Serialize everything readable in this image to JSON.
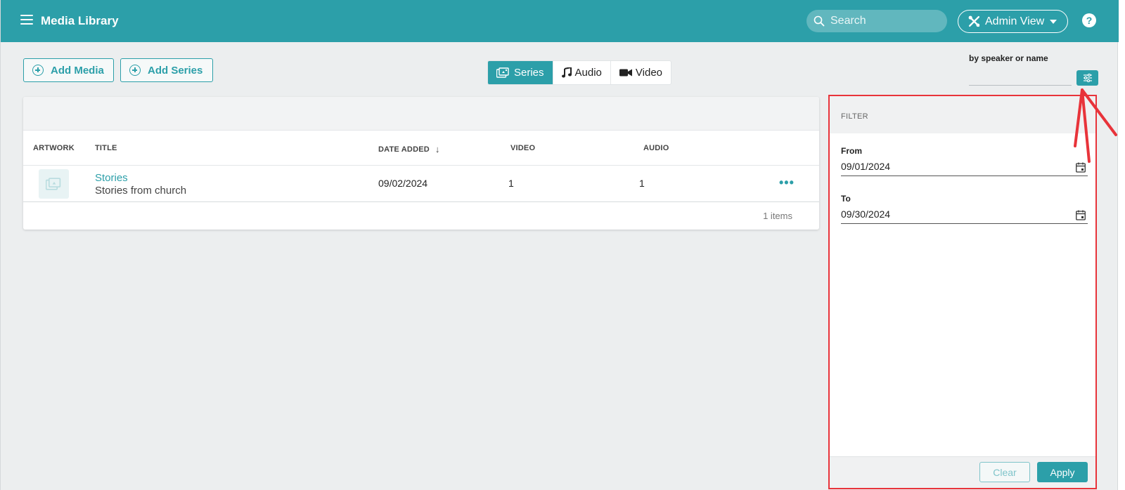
{
  "header": {
    "title": "Media Library",
    "search_placeholder": "Search",
    "admin_label": "Admin View",
    "help_label": "?"
  },
  "actions": {
    "add_media": "Add Media",
    "add_series": "Add Series"
  },
  "tabs": [
    {
      "label": "Series",
      "active": true
    },
    {
      "label": "Audio",
      "active": false
    },
    {
      "label": "Video",
      "active": false
    }
  ],
  "speaker_filter": {
    "label": "by speaker or name",
    "value": ""
  },
  "table": {
    "columns": [
      "ARTWORK",
      "TITLE",
      "DATE ADDED",
      "VIDEO",
      "AUDIO"
    ],
    "sort_indicator": "↓",
    "rows": [
      {
        "title": "Stories",
        "subtitle": "Stories from church",
        "date_added": "09/02/2024",
        "video": "1",
        "audio": "1",
        "more": "•••"
      }
    ],
    "count_label": "1 items"
  },
  "filter_panel": {
    "heading": "FILTER",
    "from_label": "From",
    "from_value": "09/01/2024",
    "to_label": "To",
    "to_value": "09/30/2024",
    "clear_label": "Clear",
    "apply_label": "Apply"
  },
  "colors": {
    "primary": "#2c9fa9",
    "highlight": "#e8333a",
    "background": "#eceeef"
  }
}
